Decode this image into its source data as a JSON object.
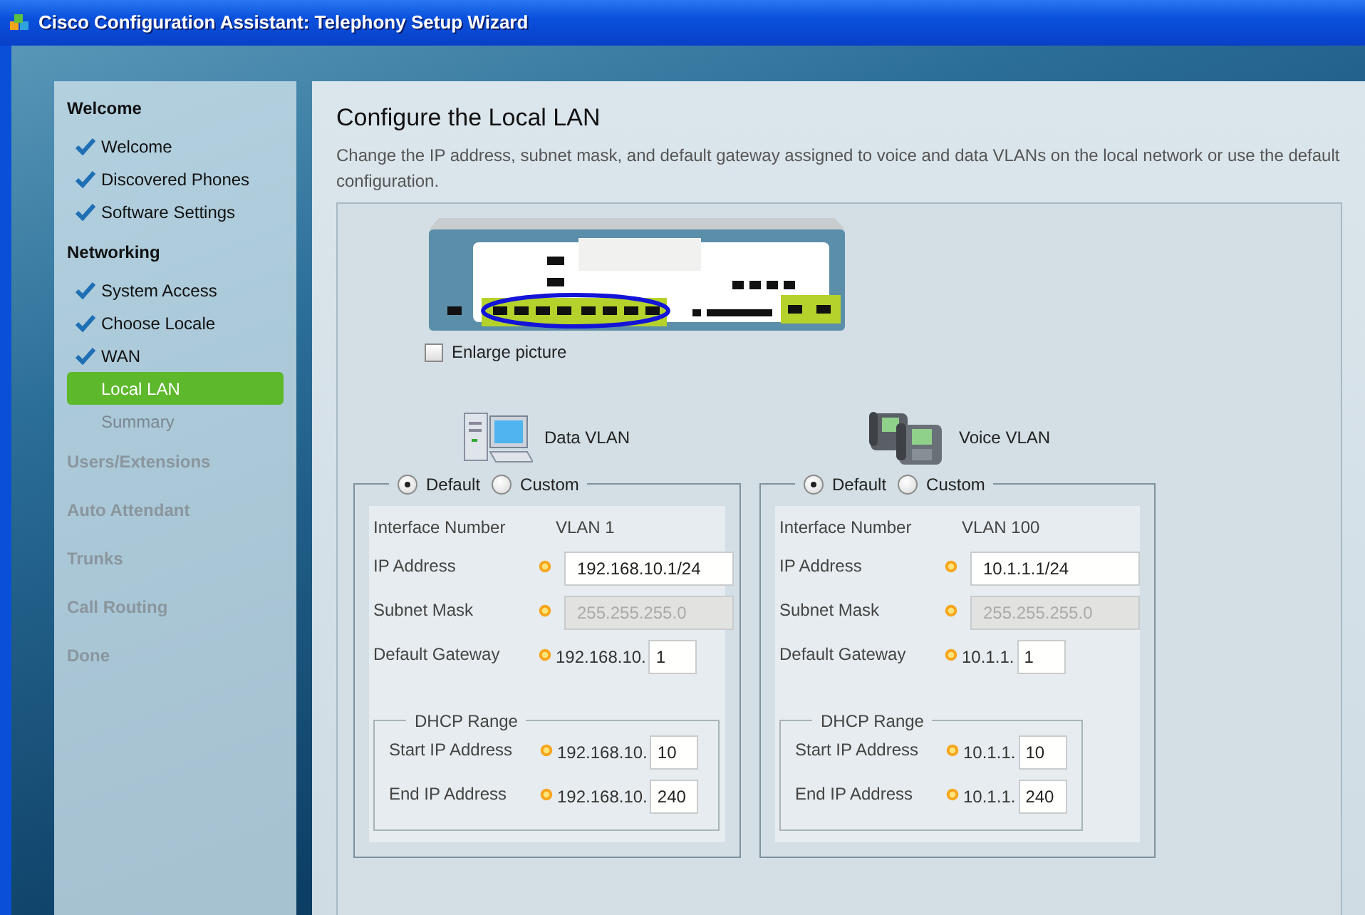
{
  "window": {
    "title": "Cisco Configuration Assistant: Telephony Setup Wizard"
  },
  "sidebar": {
    "sections": [
      {
        "title": "Welcome",
        "disabled": false,
        "items": [
          {
            "label": "Welcome",
            "checked": true,
            "selected": false,
            "disabled": false
          },
          {
            "label": "Discovered Phones",
            "checked": true,
            "selected": false,
            "disabled": false
          },
          {
            "label": "Software Settings",
            "checked": true,
            "selected": false,
            "disabled": false
          }
        ]
      },
      {
        "title": "Networking",
        "disabled": false,
        "items": [
          {
            "label": "System Access",
            "checked": true,
            "selected": false,
            "disabled": false
          },
          {
            "label": "Choose Locale",
            "checked": true,
            "selected": false,
            "disabled": false
          },
          {
            "label": "WAN",
            "checked": true,
            "selected": false,
            "disabled": false
          },
          {
            "label": "Local LAN",
            "checked": false,
            "selected": true,
            "disabled": false
          },
          {
            "label": "Summary",
            "checked": false,
            "selected": false,
            "disabled": true
          }
        ]
      },
      {
        "title": "Users/Extensions",
        "disabled": true
      },
      {
        "title": "Auto Attendant",
        "disabled": true
      },
      {
        "title": "Trunks",
        "disabled": true
      },
      {
        "title": "Call Routing",
        "disabled": true
      },
      {
        "title": "Done",
        "disabled": true
      }
    ]
  },
  "main": {
    "title": "Configure the Local LAN",
    "description": "Change the IP address, subnet mask, and default gateway assigned to voice and data VLANs on the local network or use the default configuration.",
    "enlarge_checkbox": {
      "label": "Enlarge picture",
      "checked": false
    },
    "vlans": [
      {
        "title": "Data VLAN",
        "options": [
          {
            "label": "Default",
            "selected": true
          },
          {
            "label": "Custom",
            "selected": false
          }
        ],
        "interface": {
          "label": "Interface Number",
          "value": "VLAN 1"
        },
        "fields": [
          {
            "label": "IP Address",
            "kind": "full",
            "value": "192.168.10.1/24",
            "disabled": false
          },
          {
            "label": "Subnet Mask",
            "kind": "full",
            "value": "255.255.255.0",
            "disabled": true
          },
          {
            "label": "Default Gateway",
            "kind": "prefix",
            "prefix": "192.168.10.",
            "value": "1",
            "disabled": false
          }
        ],
        "dhcp": {
          "legend": "DHCP Range",
          "fields": [
            {
              "label": "Start IP Address",
              "kind": "prefix",
              "prefix": "192.168.10.",
              "value": "10",
              "disabled": false
            },
            {
              "label": "End IP Address",
              "kind": "prefix",
              "prefix": "192.168.10.",
              "value": "240",
              "disabled": false
            }
          ]
        }
      },
      {
        "title": "Voice VLAN",
        "options": [
          {
            "label": "Default",
            "selected": true
          },
          {
            "label": "Custom",
            "selected": false
          }
        ],
        "interface": {
          "label": "Interface Number",
          "value": "VLAN 100"
        },
        "fields": [
          {
            "label": "IP Address",
            "kind": "full",
            "value": "10.1.1.1/24",
            "disabled": false
          },
          {
            "label": "Subnet Mask",
            "kind": "full",
            "value": "255.255.255.0",
            "disabled": true
          },
          {
            "label": "Default Gateway",
            "kind": "prefix",
            "prefix": "10.1.1.",
            "value": "1",
            "disabled": false
          }
        ],
        "dhcp": {
          "legend": "DHCP Range",
          "fields": [
            {
              "label": "Start IP Address",
              "kind": "prefix",
              "prefix": "10.1.1.",
              "value": "10",
              "disabled": false
            },
            {
              "label": "End IP Address",
              "kind": "prefix",
              "prefix": "10.1.1.",
              "value": "240",
              "disabled": false
            }
          ]
        }
      }
    ]
  }
}
